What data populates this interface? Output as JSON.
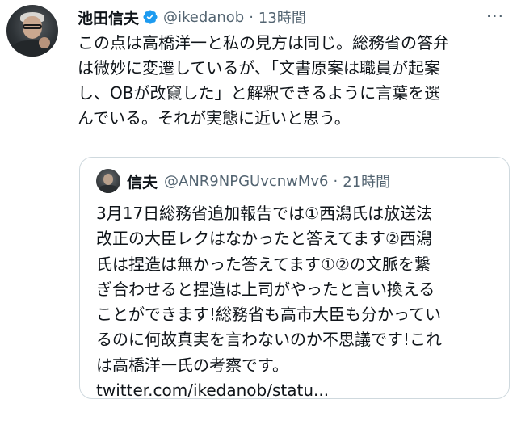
{
  "tweet": {
    "display_name": "池田信夫",
    "handle": "@ikedanob",
    "separator": "·",
    "time": "13時間",
    "more_label": "···",
    "text": "この点は高橋洋一と私の見方は同じ。総務省の答弁\nは微妙に変遷しているが、「文書原案は職員が起案\nし、OBが改竄した」と解釈できるように言葉を選\nんでいる。それが実態に近いと思う。"
  },
  "quote": {
    "display_name": "信夫",
    "handle": "@ANR9NPGUvcnwMv6",
    "separator": "·",
    "time": "21時間",
    "text": "3月17日総務省追加報告では①西潟氏は放送法\n改正の大臣レクはなかったと答えてます②西潟\n氏は捏造は無かった答えてます①②の文脈を繋\nぎ合わせると捏造は上司がやったと言い換える\nことができます!総務省も高市大臣も分かってい\nるのに何故真実を言わないのか不思議です!これ\nは高橋洋一氏の考察です。",
    "link": "twitter.com/ikedanob/statu..."
  },
  "colors": {
    "verified_badge": "#1d9bf0",
    "secondary_text": "#536471",
    "border": "#cfd9de"
  },
  "icons": {
    "verified": "verified-badge-icon",
    "more": "more-options-icon"
  }
}
